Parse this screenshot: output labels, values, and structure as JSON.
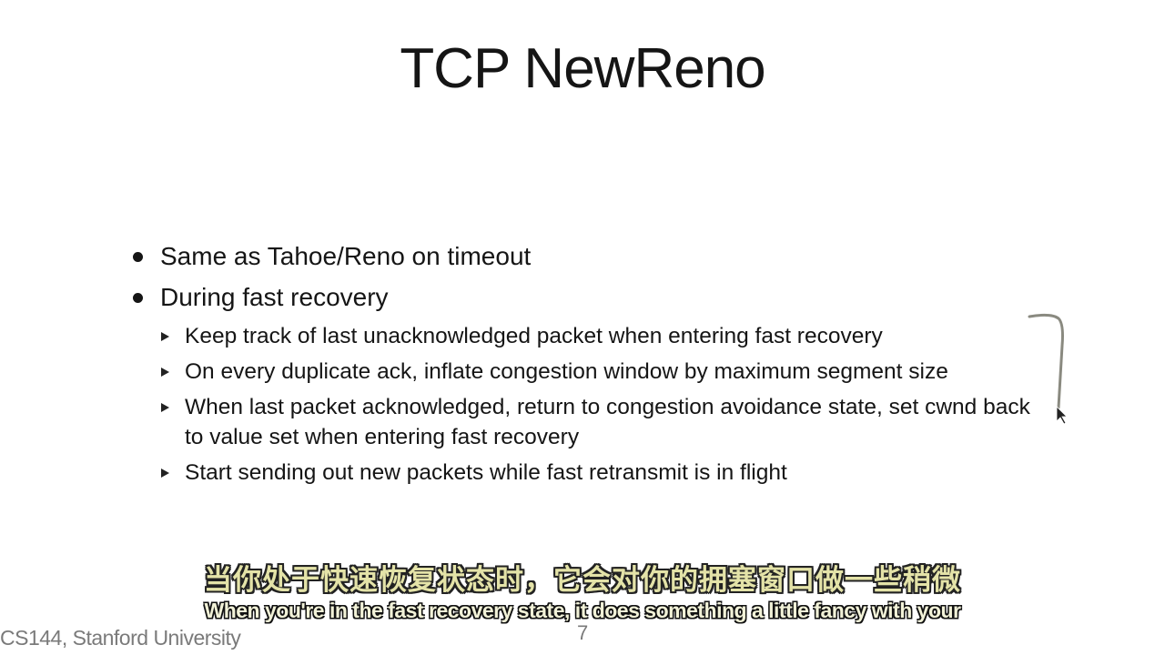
{
  "slide": {
    "title": "TCP NewReno",
    "bullets": [
      {
        "text": "Same as Tahoe/Reno on timeout"
      },
      {
        "text": "During fast recovery"
      }
    ],
    "sub_bullets": [
      "Keep track of last unacknowledged packet when entering fast recovery",
      "On every duplicate ack, inflate congestion window by maximum segment size",
      "When last packet acknowledged, return to congestion avoidance state, set cwnd back to value set when entering fast recovery",
      "Start sending out new packets while fast retransmit is in flight"
    ],
    "footer": "CS144, Stanford University",
    "page_number": "7"
  },
  "subtitles": {
    "chinese": "当你处于快速恢复状态时，它会对你的拥塞窗口做一些稍微",
    "english": "When you're in the fast recovery state, it does something a little fancy with your"
  },
  "colors": {
    "annotation": "#8a8a80",
    "subtitle_zh": "#e4e3a8",
    "footer": "#7a7a7a"
  }
}
